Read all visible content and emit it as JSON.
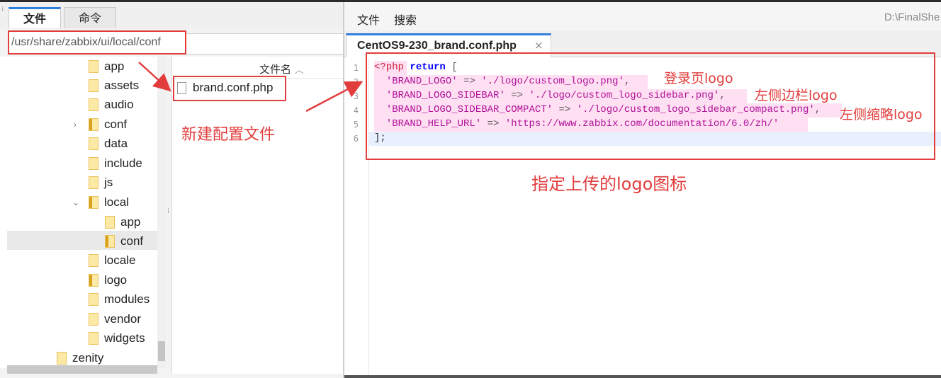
{
  "left_panel": {
    "tabs": [
      {
        "label": "文件"
      },
      {
        "label": "命令"
      }
    ],
    "path": "/usr/share/zabbix/ui/local/conf",
    "tree": [
      {
        "label": "app"
      },
      {
        "label": "assets"
      },
      {
        "label": "audio"
      },
      {
        "label": "conf"
      },
      {
        "label": "data"
      },
      {
        "label": "include"
      },
      {
        "label": "js"
      },
      {
        "label": "local"
      },
      {
        "label": "app"
      },
      {
        "label": "conf"
      },
      {
        "label": "locale"
      },
      {
        "label": "logo"
      },
      {
        "label": "modules"
      },
      {
        "label": "vendor"
      },
      {
        "label": "widgets"
      },
      {
        "label": "zenity"
      }
    ],
    "file_list": {
      "column_header": "文件名",
      "files": [
        {
          "name": "brand.conf.php"
        }
      ]
    }
  },
  "editor": {
    "menu": [
      "文件",
      "搜索"
    ],
    "path_hint": "D:\\FinalShe",
    "tab_label": "CentOS9-230_brand.conf.php",
    "close_glyph": "×",
    "line_numbers": [
      "1",
      "2",
      "3",
      "4",
      "5",
      "6"
    ],
    "code": {
      "l1_open": "<?php",
      "l1_kw": "return",
      "l1_bracket": "[",
      "l2_key": "'BRAND_LOGO'",
      "l2_arrow": "=>",
      "l2_val": "'./logo/custom_logo.png'",
      "l3_key": "'BRAND_LOGO_SIDEBAR'",
      "l3_arrow": "=>",
      "l3_val": "'./logo/custom_logo_sidebar.png'",
      "l4_key": "'BRAND_LOGO_SIDEBAR_COMPACT'",
      "l4_arrow": "=>",
      "l4_val": "'./logo/custom_logo_sidebar_compact.png'",
      "l5_key": "'BRAND_HELP_URL'",
      "l5_arrow": "=>",
      "l5_val": "'https://www.zabbix.com/documentation/6.0/zh/'",
      "l6": "];"
    }
  },
  "annotations": {
    "new_config": "新建配置文件",
    "login_logo": "登录页logo",
    "sidebar_logo": "左侧边栏logo",
    "compact_logo": "左侧缩略logo",
    "specify_logo": "指定上传的logo图标"
  },
  "colors": {
    "annotation_red": "#e23d3d",
    "keyword_blue": "#0000ff",
    "string_magenta": "#b1109a",
    "highlight_pink": "#ffdff2",
    "tab_accent": "#2f7fdc"
  }
}
